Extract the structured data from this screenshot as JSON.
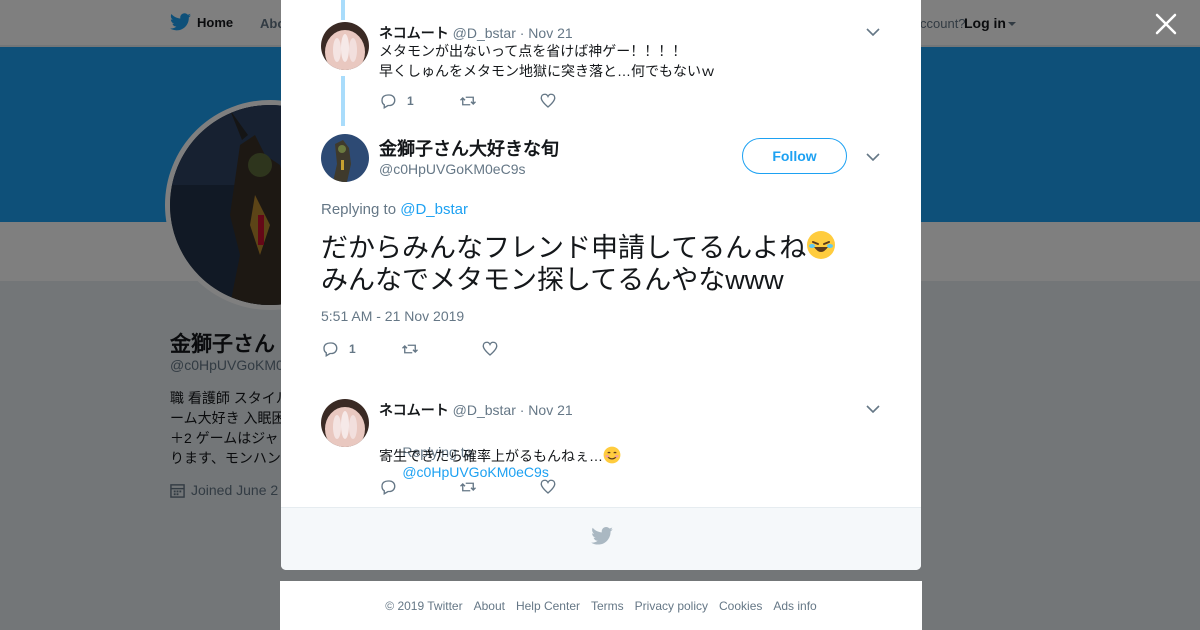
{
  "nav": {
    "home": "Home",
    "about": "Abo",
    "account": "ccount?",
    "login": "Log in"
  },
  "background_profile": {
    "name": "金獅子さん",
    "handle": "@c0HpUVGoKM0",
    "bio": "職 看護師 スタイル\nーム大好き 入眠困\n＋2 ゲームはジャ\nります、モンハン",
    "joined": "Joined June 2"
  },
  "thread": {
    "parent": {
      "name": "ネコムート",
      "handle": "@D_bstar",
      "date": "· Nov 21",
      "text": "メタモンが出ないって点を省けば神ゲー！！！！\n早くしゅんをメタモン地獄に突き落と…何でもないｗ",
      "reply_count": "1"
    },
    "main": {
      "name": "金獅子さん大好きな旬",
      "handle": "@c0HpUVGoKM0eC9s",
      "follow_label": "Follow",
      "replying_label": "Replying to",
      "replying_handle": "@D_bstar",
      "text_line1": "だからみんなフレンド申請してるんよね",
      "text_line2": "みんなでメタモン探してるんやなwww",
      "timestamp": "5:51 AM - 21 Nov 2019",
      "reply_count": "1"
    },
    "reply": {
      "name": "ネコムート",
      "handle": "@D_bstar",
      "date": "· Nov 21",
      "replying_label": "Replying to",
      "replying_handle": "@c0HpUVGoKM0eC9s",
      "text": "寄生できたら確率上がるもんねぇ…"
    }
  },
  "footer": {
    "links": [
      "© 2019 Twitter",
      "About",
      "Help Center",
      "Terms",
      "Privacy policy",
      "Cookies",
      "Ads info"
    ]
  },
  "colors": {
    "brand": "#1da1f2",
    "thread_line": "#a9dcfb",
    "muted": "#657786"
  },
  "icons": [
    "twitter-bird-icon",
    "close-icon",
    "reply-icon",
    "retweet-icon",
    "heart-icon",
    "chevron-down-icon",
    "calendar-icon",
    "emoji-rofl",
    "emoji-smile"
  ]
}
